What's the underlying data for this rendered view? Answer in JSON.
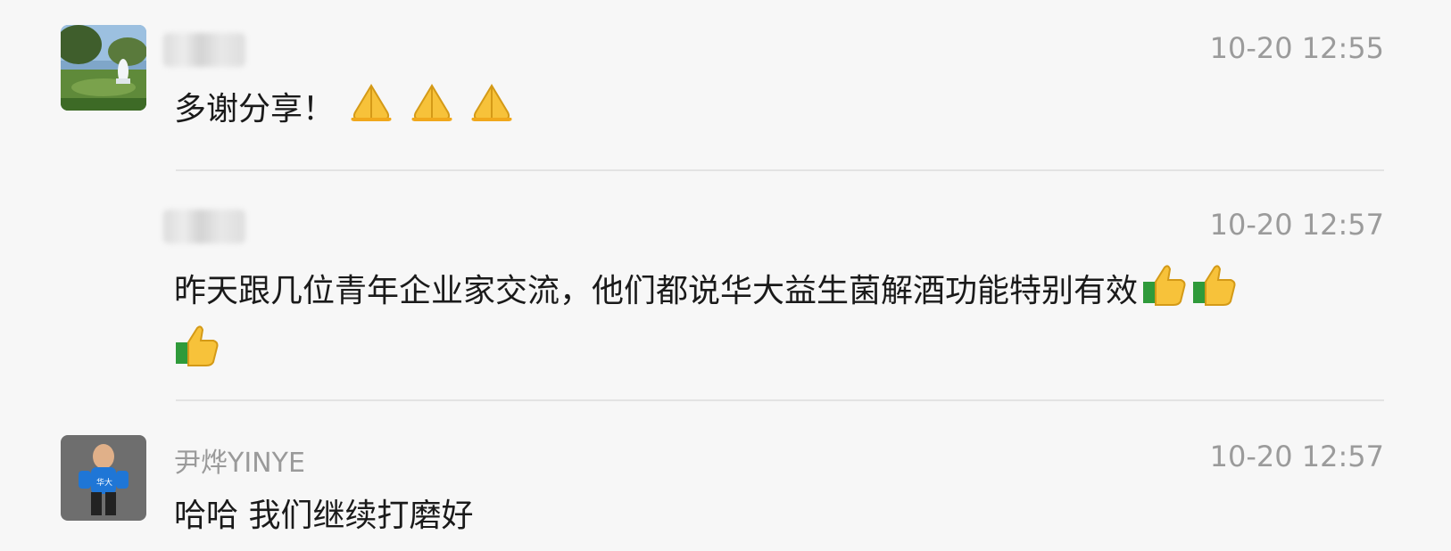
{
  "comments": [
    {
      "author": "",
      "time": "10-20 12:55",
      "text": "多谢分享！",
      "emoji": [
        "pray-emoji",
        "pray-emoji",
        "pray-emoji"
      ]
    },
    {
      "author": "",
      "time": "10-20 12:57",
      "text": "昨天跟几位青年企业家交流，他们都说华大益生菌解酒功能特别有效",
      "emoji": [
        "thumbs-up-emoji",
        "thumbs-up-emoji",
        "thumbs-up-emoji"
      ]
    },
    {
      "author": "尹烨YINYE",
      "time": "10-20 12:57",
      "text": "哈哈 我们继续打磨好"
    }
  ],
  "colors": {
    "background": "#f7f7f7",
    "name_gray": "#9a9a9a",
    "time_gray": "#9b9b9b",
    "text": "#1a1a1a",
    "divider": "#e3e3e3"
  }
}
